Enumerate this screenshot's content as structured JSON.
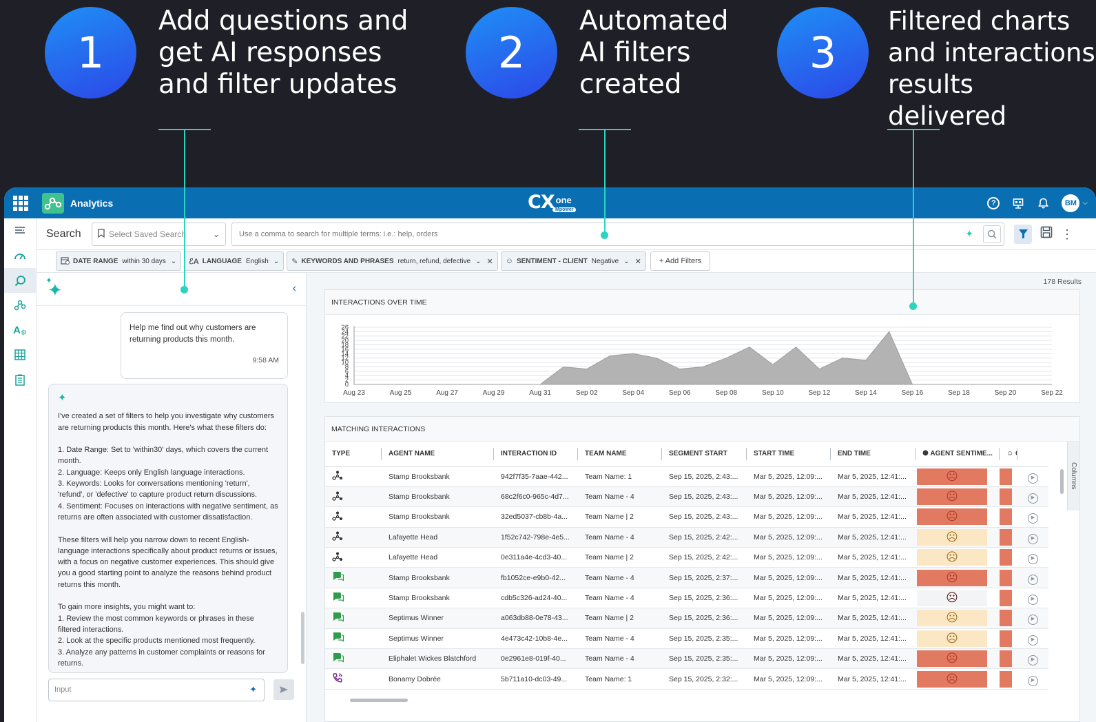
{
  "steps": [
    {
      "number": "1",
      "text": "Add questions and\nget AI responses\nand filter updates"
    },
    {
      "number": "2",
      "text": "Automated\nAI filters\ncreated"
    },
    {
      "number": "3",
      "text": "Filtered charts\nand interactions\nresults delivered"
    }
  ],
  "topbar": {
    "app_name": "Analytics",
    "brand_cx": "CX",
    "brand_one": "one",
    "brand_mpower": "Mpower",
    "avatar_initials": "BM"
  },
  "search": {
    "label": "Search",
    "saved_placeholder": "Select Saved Search",
    "input_placeholder": "Use a comma to search for multiple terms: i.e.: help, orders"
  },
  "filters": [
    {
      "name": "DATE RANGE",
      "value": "within 30 days",
      "removable": false
    },
    {
      "name": "LANGUAGE",
      "value": "English",
      "removable": false
    },
    {
      "name": "KEYWORDS AND PHRASES",
      "value": "return, refund, defective",
      "removable": true
    },
    {
      "name": "SENTIMENT - CLIENT",
      "value": "Negative",
      "removable": true
    }
  ],
  "add_filters_label": "+ Add Filters",
  "ai": {
    "user_message": "Help me find out why customers are returning products this month.",
    "user_time": "9:58 AM",
    "response": "I've created a set of filters to help you investigate why customers are returning products this month. Here's what these filters do:\n\n1. Date Range: Set to 'within30' days, which covers the current month.\n2. Language: Keeps only English language interactions.\n3. Keywords: Looks for conversations mentioning 'return', 'refund', or 'defective' to capture product return discussions.\n4. Sentiment: Focuses on interactions with negative sentiment, as returns are often associated with customer dissatisfaction.\n\nThese filters will help you narrow down to recent English-language interactions specifically about product returns or issues, with a focus on negative customer experiences. This should give you a good starting point to analyze the reasons behind product returns this month.\n\nTo gain more insights, you might want to:\n1. Review the most common keywords or phrases in these filtered interactions.\n2. Look at the specific products mentioned most frequently.\n3. Analyze any patterns in customer complaints or reasons for returns.",
    "input_placeholder": "Input"
  },
  "results_count": "178 Results",
  "chart_card_title": "INTERACTIONS OVER TIME",
  "chart_data": {
    "type": "area",
    "title": "INTERACTIONS OVER TIME",
    "x": [
      "Aug 23",
      "Aug 24",
      "Aug 25",
      "Aug 26",
      "Aug 27",
      "Aug 28",
      "Aug 29",
      "Aug 30",
      "Aug 31",
      "Sep 01",
      "Sep 02",
      "Sep 03",
      "Sep 04",
      "Sep 05",
      "Sep 06",
      "Sep 07",
      "Sep 08",
      "Sep 09",
      "Sep 10",
      "Sep 11",
      "Sep 12",
      "Sep 13",
      "Sep 14",
      "Sep 15",
      "Sep 16",
      "Sep 17",
      "Sep 18",
      "Sep 19",
      "Sep 20",
      "Sep 21",
      "Sep 22"
    ],
    "values": [
      0,
      0,
      0,
      0,
      0,
      0,
      0,
      0,
      0,
      8,
      7,
      13,
      14,
      12,
      7,
      8,
      12,
      17,
      9,
      17,
      7,
      12,
      11,
      24,
      0,
      0,
      0,
      0,
      0,
      0,
      0
    ],
    "x_tick_labels": [
      "Aug 23",
      "Aug 25",
      "Aug 27",
      "Aug 29",
      "Aug 31",
      "Sep 02",
      "Sep 04",
      "Sep 06",
      "Sep 08",
      "Sep 10",
      "Sep 12",
      "Sep 14",
      "Sep 16",
      "Sep 18",
      "Sep 20",
      "Sep 22"
    ],
    "y_ticks": [
      "0",
      "2",
      "4",
      "6",
      "8",
      "10",
      "12",
      "14",
      "16",
      "18",
      "20",
      "22",
      "24",
      "26"
    ],
    "ylim": [
      0,
      26
    ],
    "grid": true,
    "color": "#b3b3b3"
  },
  "table_card_title": "MATCHING INTERACTIONS",
  "table": {
    "columns": [
      "TYPE",
      "AGENT NAME",
      "INTERACTION ID",
      "TEAM NAME",
      "SEGMENT START",
      "START TIME",
      "END TIME",
      "AGENT SENTIME...",
      "C"
    ],
    "rows": [
      {
        "type": "interaction",
        "agent": "Stamp Brooksbank",
        "id": "942f7f35-7aae-442...",
        "team": "Team Name: 1",
        "segment": "Sep 15, 2025, 2:43:...",
        "start": "Mar 5, 2025, 12:09:...",
        "end": "Mar 5, 2025, 12:41:...",
        "sentiment": "negative"
      },
      {
        "type": "interaction",
        "agent": "Stamp Brooksbank",
        "id": "68c2f6c0-965c-4d7...",
        "team": "Team Name - 4",
        "segment": "Sep 15, 2025, 2:43:...",
        "start": "Mar 5, 2025, 12:09:...",
        "end": "Mar 5, 2025, 12:41:...",
        "sentiment": "negative"
      },
      {
        "type": "interaction",
        "agent": "Stamp Brooksbank",
        "id": "32ed5037-cb8b-4a...",
        "team": "Team Name | 2",
        "segment": "Sep 15, 2025, 2:43:...",
        "start": "Mar 5, 2025, 12:09:...",
        "end": "Mar 5, 2025, 12:41:...",
        "sentiment": "negative"
      },
      {
        "type": "interaction",
        "agent": "Lafayette Head",
        "id": "1f52c742-798e-4e5...",
        "team": "Team Name - 4",
        "segment": "Sep 15, 2025, 2:42:...",
        "start": "Mar 5, 2025, 12:09:...",
        "end": "Mar 5, 2025, 12:41:...",
        "sentiment": "mixed"
      },
      {
        "type": "interaction",
        "agent": "Lafayette Head",
        "id": "0e311a4e-4cd3-40...",
        "team": "Team Name | 2",
        "segment": "Sep 15, 2025, 2:42:...",
        "start": "Mar 5, 2025, 12:09:...",
        "end": "Mar 5, 2025, 12:41:...",
        "sentiment": "mixed"
      },
      {
        "type": "chat",
        "agent": "Stamp Brooksbank",
        "id": "fb1052ce-e9b0-42...",
        "team": "Team Name - 4",
        "segment": "Sep 15, 2025, 2:37:...",
        "start": "Mar 5, 2025, 12:09:...",
        "end": "Mar 5, 2025, 12:41:...",
        "sentiment": "negative"
      },
      {
        "type": "chat",
        "agent": "Stamp Brooksbank",
        "id": "cdb5c326-ad24-40...",
        "team": "Team Name - 4",
        "segment": "Sep 15, 2025, 2:36:...",
        "start": "Mar 5, 2025, 12:09:...",
        "end": "Mar 5, 2025, 12:41:...",
        "sentiment": "neutral"
      },
      {
        "type": "chat",
        "agent": "Septimus Winner",
        "id": "a063db88-0e78-43...",
        "team": "Team Name | 2",
        "segment": "Sep 15, 2025, 2:36:...",
        "start": "Mar 5, 2025, 12:09:...",
        "end": "Mar 5, 2025, 12:41:...",
        "sentiment": "mixed"
      },
      {
        "type": "chat",
        "agent": "Septimus Winner",
        "id": "4e473c42-10b8-4e...",
        "team": "Team Name - 4",
        "segment": "Sep 15, 2025, 2:35:...",
        "start": "Mar 5, 2025, 12:09:...",
        "end": "Mar 5, 2025, 12:41:...",
        "sentiment": "mixed"
      },
      {
        "type": "chat",
        "agent": "Eliphalet Wickes Blatchford",
        "id": "0e2961e8-019f-40...",
        "team": "Team Name - 4",
        "segment": "Sep 15, 2025, 2:35:...",
        "start": "Mar 5, 2025, 12:09:...",
        "end": "Mar 5, 2025, 12:41:...",
        "sentiment": "negative"
      },
      {
        "type": "voice",
        "agent": "Bonamy Dobrée",
        "id": "5b711a10-dc03-49...",
        "team": "Team Name: 1",
        "segment": "Sep 15, 2025, 2:32:...",
        "start": "Mar 5, 2025, 12:09:...",
        "end": "Mar 5, 2025, 12:41:...",
        "sentiment": "negative"
      }
    ],
    "columns_tab_label": "Columns"
  },
  "colors": {
    "accent": "#0a6fb2",
    "teal": "#2cd3c1",
    "negative": "#e27a62",
    "mixed": "#fbe7c3"
  }
}
